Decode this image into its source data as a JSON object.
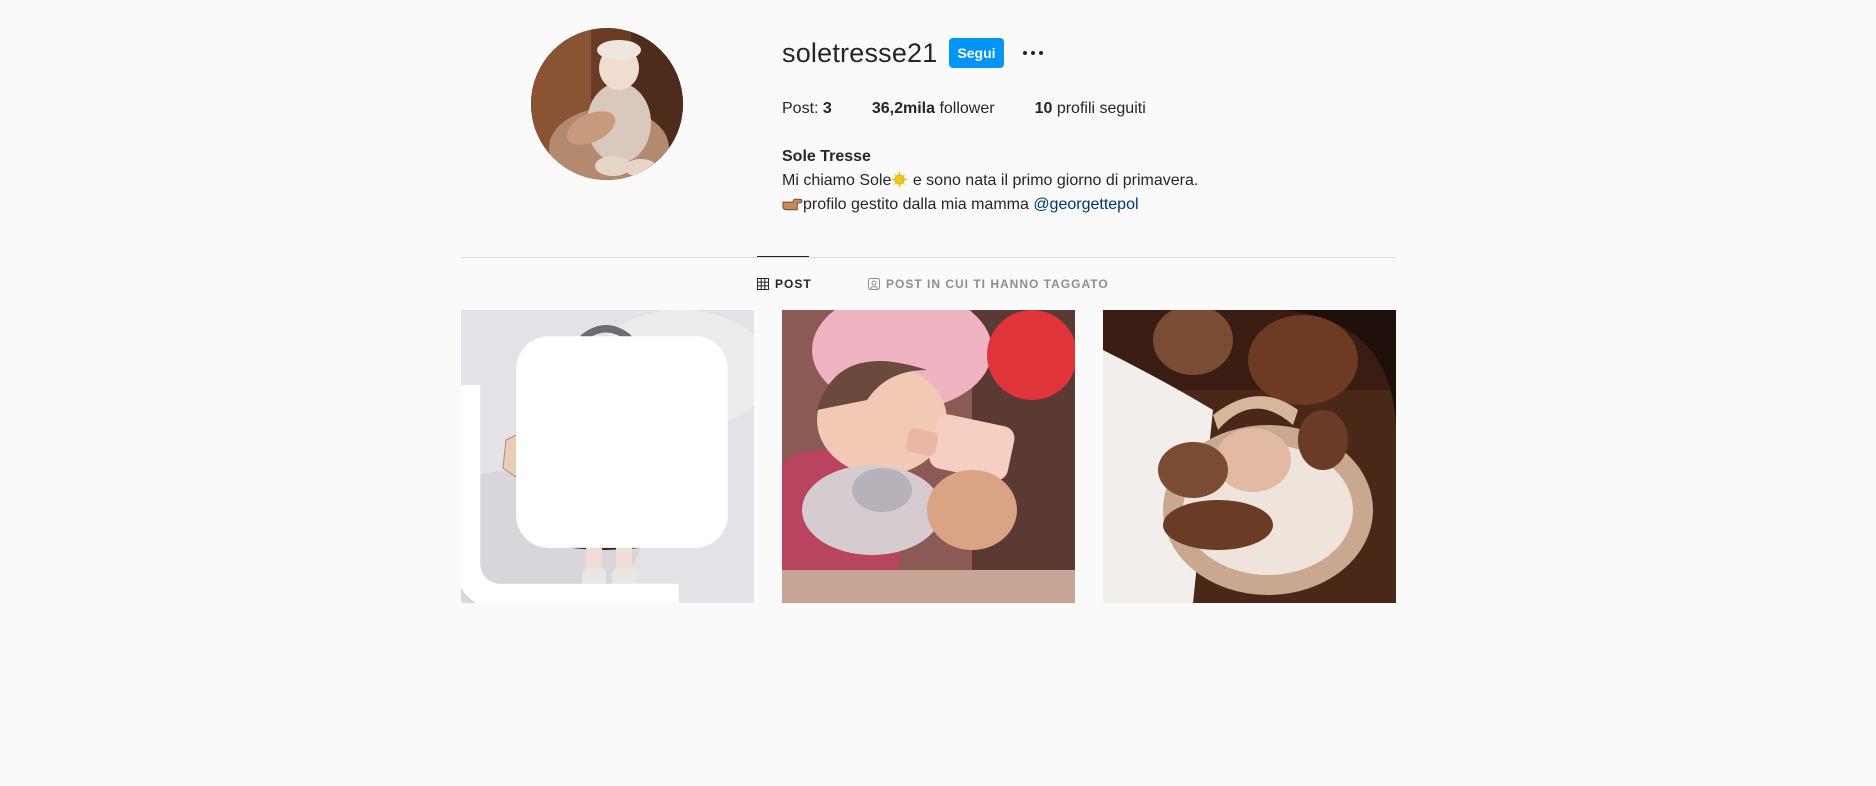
{
  "profile": {
    "username": "soletresse21",
    "follow_label": "Segui",
    "stats": {
      "posts_label": "Post:",
      "posts_count": "3",
      "followers_count": "36,2mila",
      "followers_label": "follower",
      "following_count": "10",
      "following_label": "profili seguiti"
    },
    "bio": {
      "name": "Sole Tresse",
      "line1_before": "Mi chiamo Sole",
      "line1_after": " e sono nata il primo giorno di primavera.",
      "line2_text": "profilo gestito dalla mia mamma ",
      "mention": "@georgettepol"
    }
  },
  "tabs": [
    {
      "label": "POST",
      "icon": "grid-icon",
      "active": true
    },
    {
      "label": "POST IN CUI TI HANNO TAGGATO",
      "icon": "tagged-icon",
      "active": false
    }
  ],
  "posts": [
    {
      "kind": "carousel",
      "icon": "multi-post-icon"
    },
    {
      "kind": "single"
    },
    {
      "kind": "single"
    }
  ],
  "colors": {
    "accent": "#0095f6",
    "text": "#262626",
    "muted": "#8e8e8e",
    "mention": "#00376b",
    "background": "#fafafa"
  }
}
